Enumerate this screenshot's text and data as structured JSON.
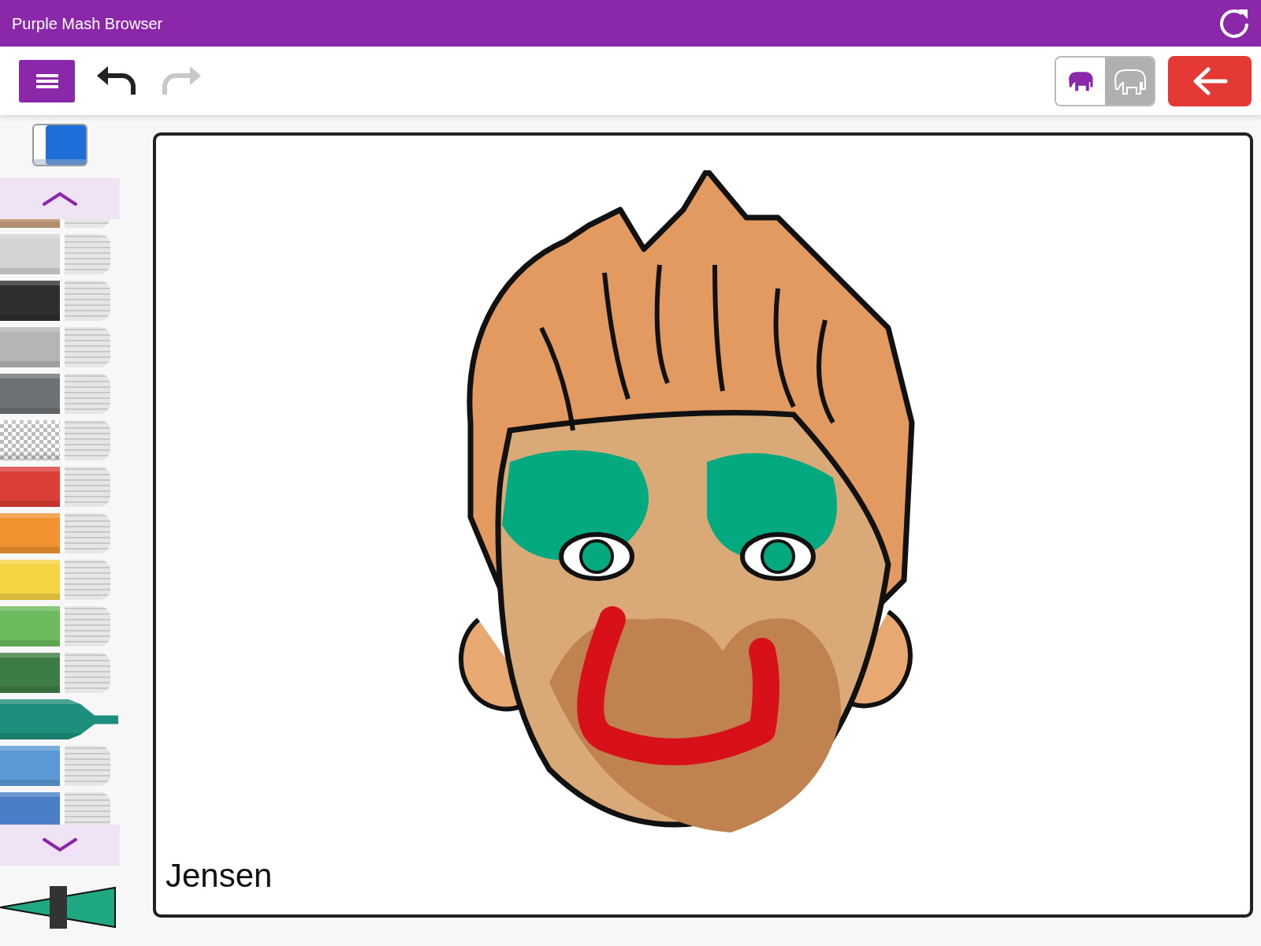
{
  "title_bar": {
    "title": "Purple Mash Browser"
  },
  "toolbar": {
    "undo_disabled": false,
    "redo_disabled": true,
    "size_modes": [
      {
        "selected": true
      },
      {
        "selected": false
      }
    ]
  },
  "pens": [
    {
      "kind": "color",
      "color": "#c9a27e",
      "selected": false
    },
    {
      "kind": "color",
      "color": "#d3d3d3",
      "selected": false
    },
    {
      "kind": "color",
      "color": "#2f2f2f",
      "selected": false
    },
    {
      "kind": "color",
      "color": "#b5b5b5",
      "selected": false
    },
    {
      "kind": "color",
      "color": "#6e7275",
      "selected": false
    },
    {
      "kind": "pattern",
      "selected": false
    },
    {
      "kind": "color",
      "color": "#dc3f37",
      "selected": false
    },
    {
      "kind": "color",
      "color": "#f0922f",
      "selected": false
    },
    {
      "kind": "color",
      "color": "#f5d443",
      "selected": false
    },
    {
      "kind": "color",
      "color": "#6bbb5e",
      "selected": false
    },
    {
      "kind": "color",
      "color": "#3d7d45",
      "selected": false
    },
    {
      "kind": "color",
      "color": "#1d8f7c",
      "selected": true
    },
    {
      "kind": "color",
      "color": "#5b9ad6",
      "selected": false
    },
    {
      "kind": "color",
      "color": "#4a7fc8",
      "selected": false
    }
  ],
  "brush_size": {
    "level": 0.5
  },
  "canvas": {
    "caption": "Jensen"
  }
}
